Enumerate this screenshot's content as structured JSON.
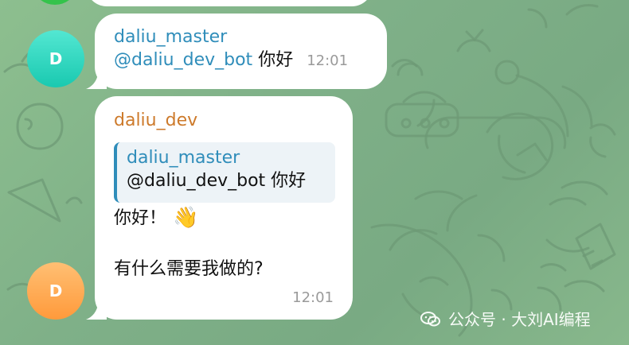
{
  "theme": {
    "background": "#86b58e",
    "pattern": "#6d9a76",
    "accent_blue": "#2f8dba",
    "accent_orange": "#cd7a2b",
    "bubble_bg": "#ffffff",
    "reply_bg": "#edf3f7"
  },
  "messages": [
    {
      "avatar": "D",
      "author": "daliu_master",
      "text_mention": "@daliu_dev_bot",
      "text_rest": "你好",
      "time": "12:01"
    },
    {
      "avatar": "D",
      "author": "daliu_dev",
      "reply": {
        "author": "daliu_master",
        "text": "@daliu_dev_bot 你好"
      },
      "lines": [
        "你好！",
        "有什么需要我做的?"
      ],
      "emoji": "👋",
      "time": "12:01"
    }
  ],
  "watermark": {
    "icon": "wechat-icon",
    "text": "公众号 · 大刘AI编程"
  }
}
